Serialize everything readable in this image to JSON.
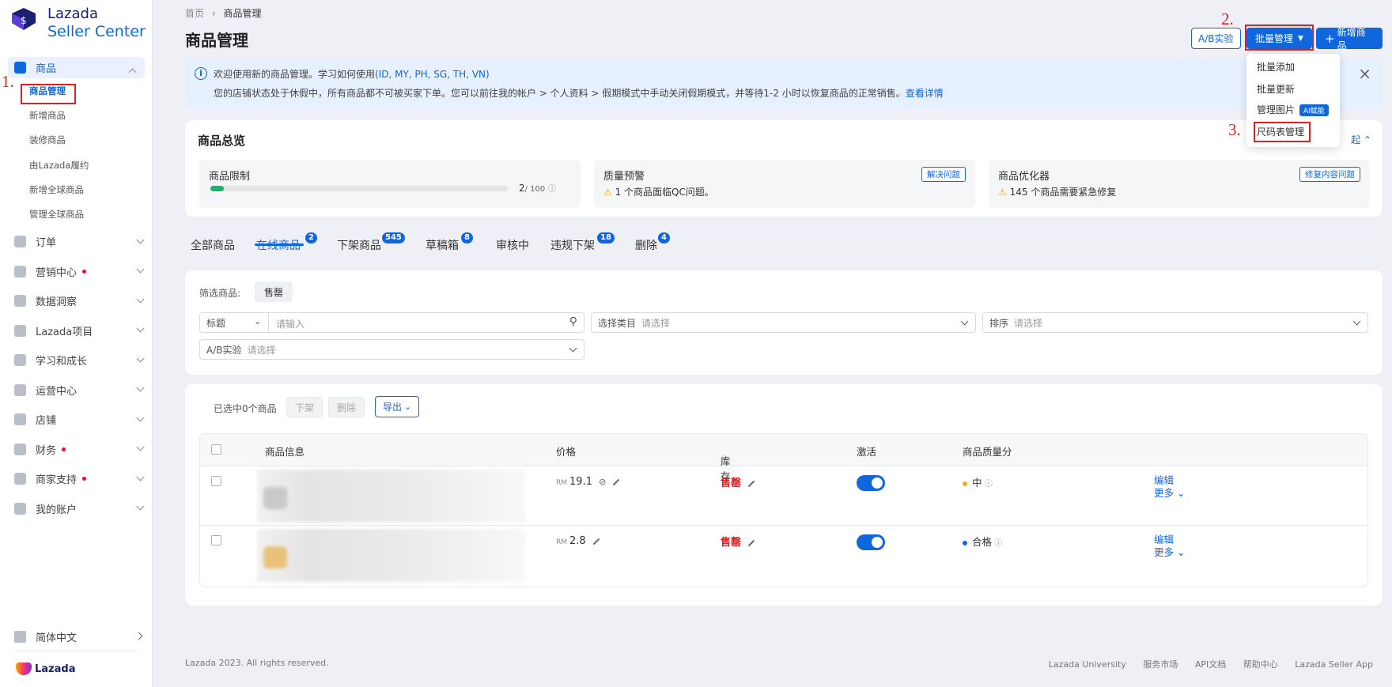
{
  "brand": {
    "name": "Lazada",
    "sub": "Seller Center",
    "footer": "Lazada"
  },
  "sidebar": {
    "items": [
      {
        "label": "商品",
        "expanded": true,
        "sub": [
          "商品管理",
          "新增商品",
          "装修商品",
          "由Lazada履约",
          "新增全球商品",
          "管理全球商品"
        ]
      },
      {
        "label": "订单"
      },
      {
        "label": "营销中心",
        "dot": true
      },
      {
        "label": "数据洞察"
      },
      {
        "label": "Lazada项目"
      },
      {
        "label": "学习和成长"
      },
      {
        "label": "运营中心"
      },
      {
        "label": "店铺"
      },
      {
        "label": "财务",
        "dot": true
      },
      {
        "label": "商家支持",
        "dot": true
      },
      {
        "label": "我的账户"
      }
    ],
    "language": "简体中文"
  },
  "annotations": {
    "n1": "1.",
    "n2": "2.",
    "n3": "3."
  },
  "header": {
    "crumb_home": "首页",
    "crumb_sep": "›",
    "crumb_current": "商品管理",
    "title": "商品管理",
    "ab_btn": "A/B实验",
    "bulk_btn": "批量管理",
    "new_btn": "新增商品"
  },
  "banner": {
    "line1": "欢迎使用新的商品管理。学习如何使用",
    "line1_link": "(ID, MY, PH, SG, TH, VN)",
    "line2": "您的店铺状态处于休假中，所有商品都不可被买家下单。您可以前往我的帐户 > 个人资料 > 假期模式中手动关闭假期模式，并等待1-2 小时以恢复商品的正常销售。",
    "line2_link": "查看详情",
    "close": "×"
  },
  "overview": {
    "title": "商品总览",
    "collapse": "起",
    "limit": {
      "label": "商品限制",
      "value": "2",
      "max": "/ 100",
      "fraction": 0.02
    },
    "quality": {
      "label": "质量预警",
      "tag": "解决问题",
      "warn": "1 个商品面临QC问题。"
    },
    "optimizer": {
      "label": "商品优化器",
      "tag": "修复内容问题",
      "warn": "145 个商品需要紧急修复"
    }
  },
  "tabs": [
    {
      "label": "全部商品"
    },
    {
      "label": "在线商品",
      "badge": "2",
      "active": true
    },
    {
      "label": "下架商品",
      "badge": "545"
    },
    {
      "label": "草稿箱",
      "badge": "8"
    },
    {
      "label": "审核中"
    },
    {
      "label": "违规下架",
      "badge": "18"
    },
    {
      "label": "删除",
      "badge": "4"
    }
  ],
  "filters": {
    "label": "筛选商品:",
    "chip": "售罄",
    "title_select": "标题",
    "search_placeholder": "请输入",
    "category_label": "选择类目",
    "category_placeholder": "请选择",
    "sort_label": "排序",
    "sort_placeholder": "请选择",
    "ab_label": "A/B实验",
    "ab_placeholder": "请选择"
  },
  "toolbar": {
    "selected": "已选中0个商品",
    "deactivate": "下架",
    "delete": "删除",
    "export": "导出"
  },
  "table": {
    "headers": [
      "商品信息",
      "价格",
      "库存",
      "激活",
      "商品质量分"
    ],
    "rows": [
      {
        "currency": "RM",
        "price": "19.1",
        "stock": "售罄",
        "active": true,
        "quality": "中",
        "quality_color": "#f5a623",
        "edit": "编辑",
        "more": "更多"
      },
      {
        "currency": "RM",
        "price": "2.8",
        "stock": "售罄",
        "active": true,
        "quality": "合格",
        "quality_color": "#1066dd",
        "edit": "编辑",
        "more": "更多"
      }
    ]
  },
  "dropdown": {
    "items": [
      "批量添加",
      "批量更新",
      "管理图片",
      "尺码表管理"
    ],
    "ai_badge": "AI赋能"
  },
  "footer": {
    "copyright": "Lazada 2023. All rights reserved.",
    "links": [
      "Lazada University",
      "服务市场",
      "API文档",
      "帮助中心",
      "Lazada Seller App"
    ]
  }
}
